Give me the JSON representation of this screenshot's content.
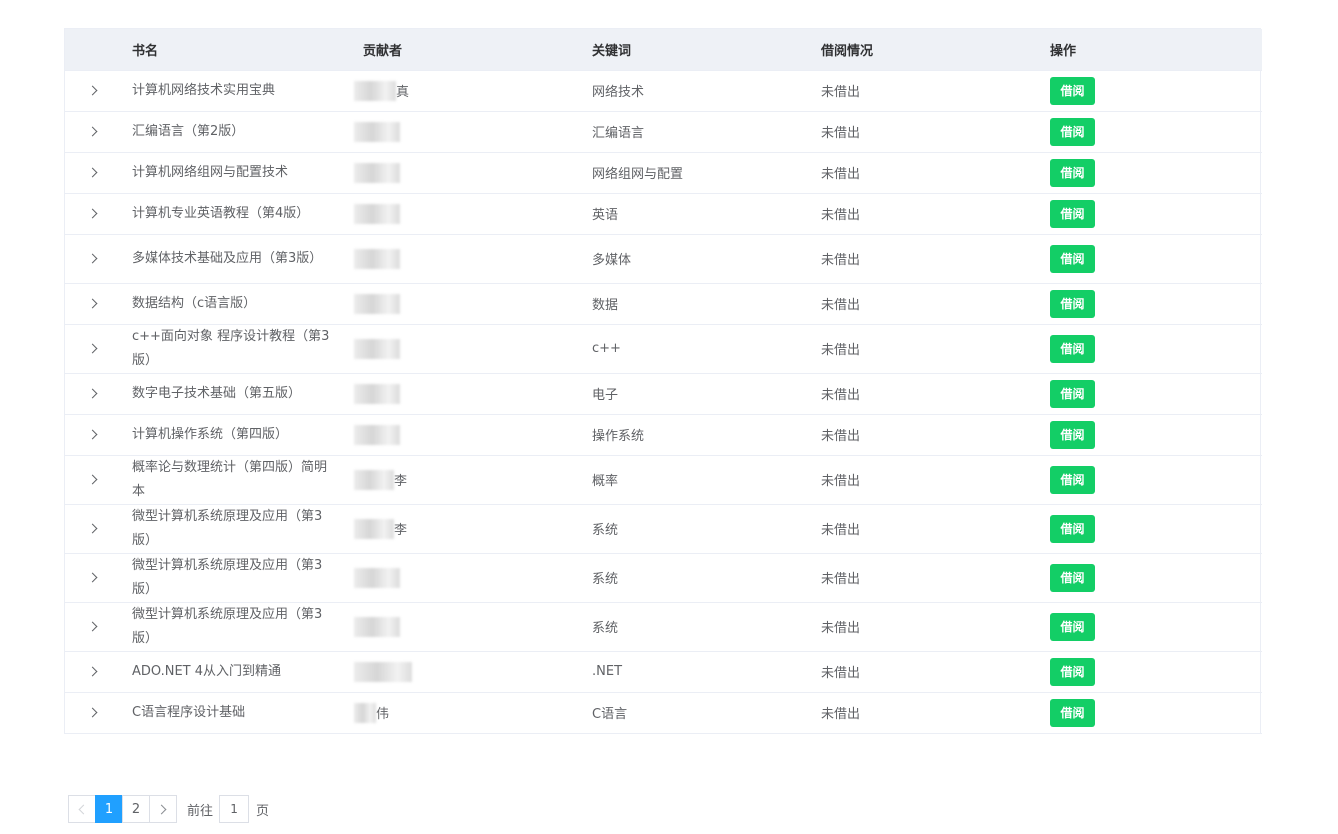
{
  "table": {
    "headers": {
      "name": "书名",
      "contributor": "贡献者",
      "keyword": "关键词",
      "status": "借阅情况",
      "action": "操作"
    },
    "rows": [
      {
        "name": "计算机网络技术实用宝典",
        "contributor_visible": "真",
        "keyword": "网络技术",
        "status": "未借出",
        "action": "借阅"
      },
      {
        "name": "汇编语言（第2版）",
        "contributor_visible": "",
        "keyword": "汇编语言",
        "status": "未借出",
        "action": "借阅"
      },
      {
        "name": "计算机网络组网与配置技术",
        "contributor_visible": "",
        "keyword": "网络组网与配置",
        "status": "未借出",
        "action": "借阅"
      },
      {
        "name": "计算机专业英语教程（第4版）",
        "contributor_visible": "",
        "keyword": "英语",
        "status": "未借出",
        "action": "借阅"
      },
      {
        "name": "多媒体技术基础及应用（第3版）",
        "contributor_visible": "",
        "keyword": "多媒体",
        "status": "未借出",
        "action": "借阅"
      },
      {
        "name": "数据结构（c语言版）",
        "contributor_visible": "",
        "keyword": "数据",
        "status": "未借出",
        "action": "借阅"
      },
      {
        "name": "c++面向对象 程序设计教程（第3版）",
        "contributor_visible": "",
        "keyword": "c++",
        "status": "未借出",
        "action": "借阅"
      },
      {
        "name": "数字电子技术基础（第五版）",
        "contributor_visible": "",
        "keyword": "电子",
        "status": "未借出",
        "action": "借阅"
      },
      {
        "name": "计算机操作系统（第四版）",
        "contributor_visible": "",
        "keyword": "操作系统",
        "status": "未借出",
        "action": "借阅"
      },
      {
        "name": "概率论与数理统计（第四版）简明本",
        "contributor_visible": "李",
        "keyword": "概率",
        "status": "未借出",
        "action": "借阅"
      },
      {
        "name": "微型计算机系统原理及应用（第3版）",
        "contributor_visible": "李",
        "keyword": "系统",
        "status": "未借出",
        "action": "借阅"
      },
      {
        "name": "微型计算机系统原理及应用（第3版）",
        "contributor_visible": "",
        "keyword": "系统",
        "status": "未借出",
        "action": "借阅"
      },
      {
        "name": "微型计算机系统原理及应用（第3版）",
        "contributor_visible": "",
        "keyword": "系统",
        "status": "未借出",
        "action": "借阅"
      },
      {
        "name": "ADO.NET 4从入门到精通",
        "contributor_visible": "",
        "keyword": ".NET",
        "status": "未借出",
        "action": "借阅"
      },
      {
        "name": "C语言程序设计基础",
        "contributor_visible": "伟",
        "keyword": "C语言",
        "status": "未借出",
        "action": "借阅"
      }
    ]
  },
  "pagination": {
    "pages": [
      "1",
      "2"
    ],
    "current": "1",
    "goto_label": "前往",
    "goto_value": "1",
    "page_suffix": "页"
  }
}
